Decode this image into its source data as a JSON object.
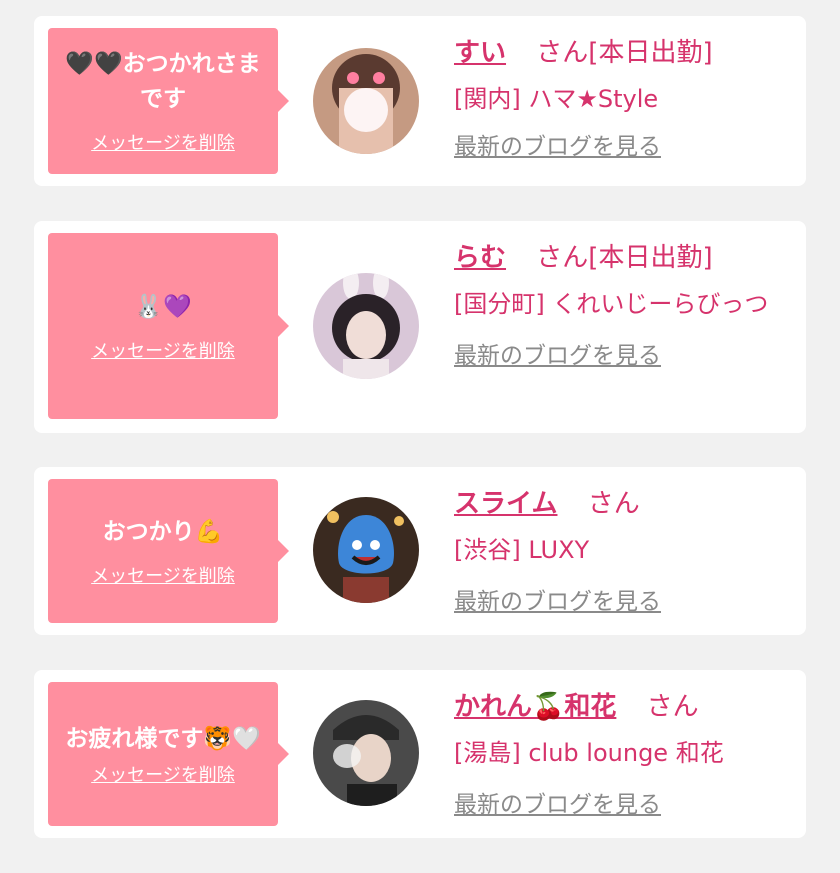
{
  "messages": [
    {
      "bubble_text": "🖤🖤おつかれさまです",
      "delete_label": "メッセージを削除",
      "name": "すい",
      "honorific": "さん",
      "status": "[本日出勤]",
      "shop": "[関内] ハマ★Style",
      "blog_label": "最新のブログを見る",
      "avatar_colors": [
        "#b07a6b",
        "#f3c5c8"
      ]
    },
    {
      "bubble_text": "🐰💜",
      "delete_label": "メッセージを削除",
      "name": "らむ",
      "honorific": "さん",
      "status": "[本日出勤]",
      "shop": "[国分町] くれいじーらびっつ",
      "blog_label": "最新のブログを見る",
      "avatar_colors": [
        "#6b5a78",
        "#e6d6e6"
      ]
    },
    {
      "bubble_text": "おつかり💪",
      "delete_label": "メッセージを削除",
      "name": "スライム",
      "honorific": "さん",
      "status": "",
      "shop": "[渋谷] LUXY",
      "blog_label": "最新のブログを見る",
      "avatar_colors": [
        "#3f7fd0",
        "#3a2a20"
      ]
    },
    {
      "bubble_text": "お疲れ様です🐯🤍",
      "delete_label": "メッセージを削除",
      "name": "かれん🍒和花",
      "honorific": "さん",
      "status": "",
      "shop": "[湯島] club lounge 和花",
      "blog_label": "最新のブログを見る",
      "avatar_colors": [
        "#3a3a3a",
        "#d9d0c8"
      ]
    }
  ]
}
